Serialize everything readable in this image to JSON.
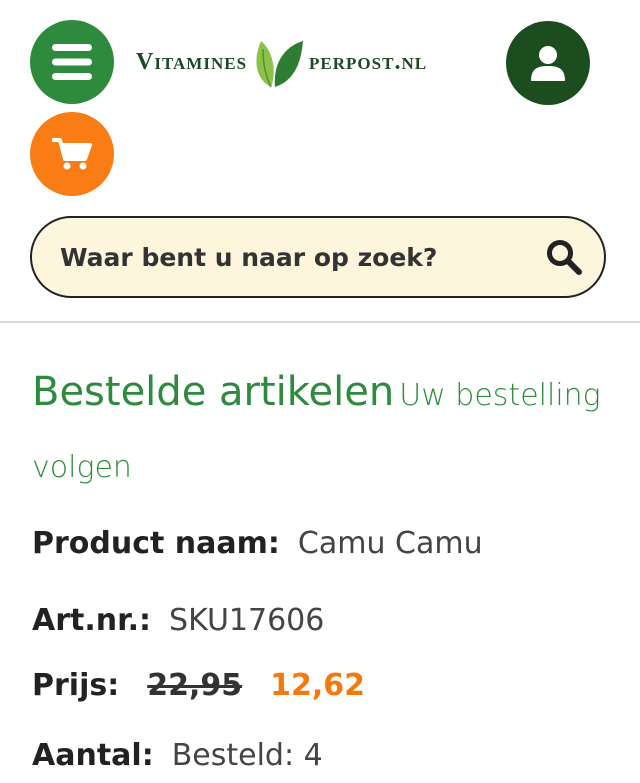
{
  "header": {
    "logo": {
      "part1": "Vitamines",
      "part2": "perpost.nl"
    },
    "icons": {
      "menu": "hamburger-icon",
      "account": "user-icon",
      "cart": "cart-icon"
    },
    "colors": {
      "green": "#2e8b3e",
      "dark_green": "#1b4d1f",
      "orange": "#f97d14"
    }
  },
  "search": {
    "placeholder": "Waar bent u naar op zoek?",
    "icon": "search-icon"
  },
  "order": {
    "title": "Bestelde artikelen",
    "track_link": "Uw bestelling volgen",
    "product_label": "Product naam:",
    "product_value": "Camu Camu",
    "artnr_label": "Art.nr.:",
    "artnr_value": "SKU17606",
    "price_label": "Prijs:",
    "price_old": "22,95",
    "price_new": "12,62",
    "quantity_label": "Aantal:",
    "quantity_value": "Besteld: 4"
  }
}
